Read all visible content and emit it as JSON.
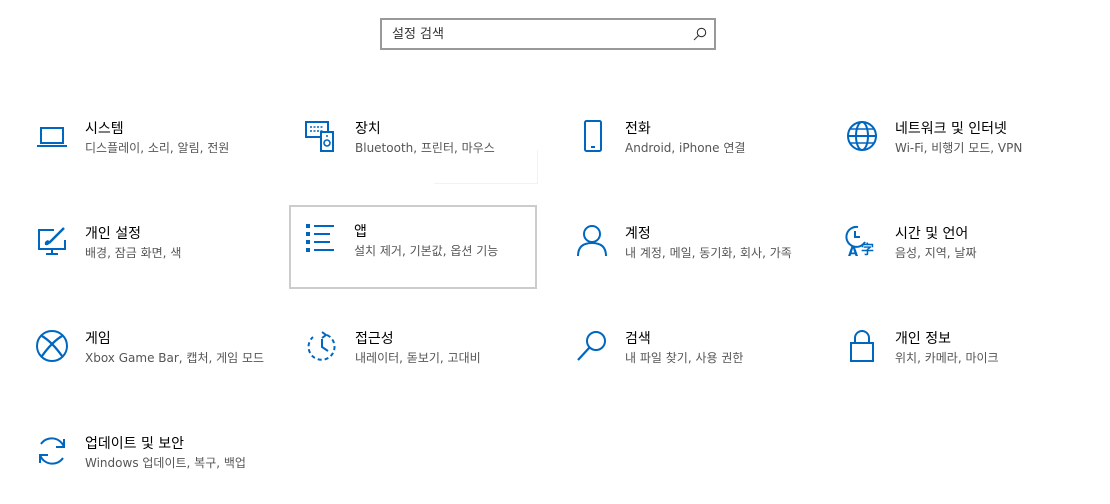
{
  "search": {
    "placeholder": "설정 검색"
  },
  "colors": {
    "accent": "#0067c0",
    "hover_border": "#cccccc",
    "desc": "#555555"
  },
  "tiles": [
    {
      "title": "시스템",
      "desc": "디스플레이, 소리, 알림, 전원",
      "icon": "laptop-icon"
    },
    {
      "title": "장치",
      "desc": "Bluetooth, 프린터, 마우스",
      "icon": "devices-icon"
    },
    {
      "title": "전화",
      "desc": "Android, iPhone 연결",
      "icon": "phone-icon"
    },
    {
      "title": "네트워크 및 인터넷",
      "desc": "Wi-Fi, 비행기 모드, VPN",
      "icon": "globe-icon"
    },
    {
      "title": "개인 설정",
      "desc": "배경, 잠금 화면, 색",
      "icon": "personalization-icon"
    },
    {
      "title": "앱",
      "desc": "설치 제거, 기본값, 옵션 기능",
      "icon": "apps-list-icon"
    },
    {
      "title": "계정",
      "desc": "내 계정, 메일, 동기화, 회사, 가족",
      "icon": "person-icon"
    },
    {
      "title": "시간 및 언어",
      "desc": "음성, 지역, 날짜",
      "icon": "time-language-icon"
    },
    {
      "title": "게임",
      "desc": "Xbox Game Bar, 캡처, 게임 모드",
      "icon": "xbox-icon"
    },
    {
      "title": "접근성",
      "desc": "내레이터, 돋보기, 고대비",
      "icon": "ease-of-access-icon"
    },
    {
      "title": "검색",
      "desc": "내 파일 찾기, 사용 권한",
      "icon": "search-icon"
    },
    {
      "title": "개인 정보",
      "desc": "위치, 카메라, 마이크",
      "icon": "lock-icon"
    },
    {
      "title": "업데이트 및 보안",
      "desc": "Windows 업데이트, 복구, 백업",
      "icon": "sync-icon"
    }
  ]
}
